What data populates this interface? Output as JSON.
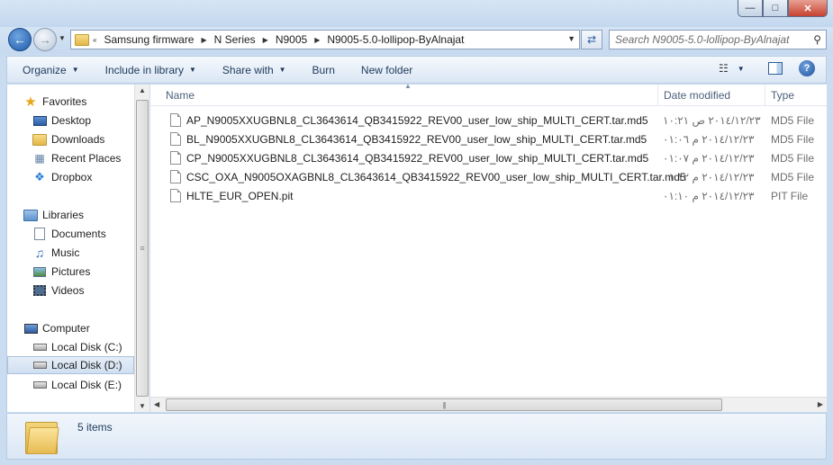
{
  "window": {
    "minimize_label": "—",
    "maximize_label": "□",
    "close_label": "✕"
  },
  "address": {
    "breadcrumbs": [
      "Samsung firmware",
      "N Series",
      "N9005",
      "N9005-5.0-lollipop-ByAlnajat"
    ],
    "overflow_label": "«"
  },
  "search": {
    "placeholder": "Search N9005-5.0-lollipop-ByAlnajat"
  },
  "toolbar": {
    "organize": "Organize",
    "include_in_library": "Include in library",
    "share_with": "Share with",
    "burn": "Burn",
    "new_folder": "New folder"
  },
  "nav": {
    "favorites": "Favorites",
    "desktop": "Desktop",
    "downloads": "Downloads",
    "recent_places": "Recent Places",
    "dropbox": "Dropbox",
    "libraries": "Libraries",
    "documents": "Documents",
    "music": "Music",
    "pictures": "Pictures",
    "videos": "Videos",
    "computer": "Computer",
    "local_c": "Local Disk (C:)",
    "local_d": "Local Disk (D:)",
    "local_e": "Local Disk (E:)"
  },
  "columns": {
    "name": "Name",
    "date_modified": "Date modified",
    "type": "Type"
  },
  "files": [
    {
      "name": "AP_N9005XXUGBNL8_CL3643614_QB3415922_REV00_user_low_ship_MULTI_CERT.tar.md5",
      "date": "٢٠١٤/١٢/٢٣ ص ١٠:٢١",
      "type": "MD5 File"
    },
    {
      "name": "BL_N9005XXUGBNL8_CL3643614_QB3415922_REV00_user_low_ship_MULTI_CERT.tar.md5",
      "date": "٢٠١٤/١٢/٢٣ م ٠١:٠٦",
      "type": "MD5 File"
    },
    {
      "name": "CP_N9005XXUGBNL8_CL3643614_QB3415922_REV00_user_low_ship_MULTI_CERT.tar.md5",
      "date": "٢٠١٤/١٢/٢٣ م ٠١:٠٧",
      "type": "MD5 File"
    },
    {
      "name": "CSC_OXA_N9005OXAGBNL8_CL3643614_QB3415922_REV00_user_low_ship_MULTI_CERT.tar.md5",
      "date": "٢٠١٤/١٢/٢٣ م ٠١:١٢",
      "type": "MD5 File"
    },
    {
      "name": "HLTE_EUR_OPEN.pit",
      "date": "٢٠١٤/١٢/٢٣ م ٠١:١٠",
      "type": "PIT File"
    }
  ],
  "details": {
    "item_count": "5 items"
  }
}
